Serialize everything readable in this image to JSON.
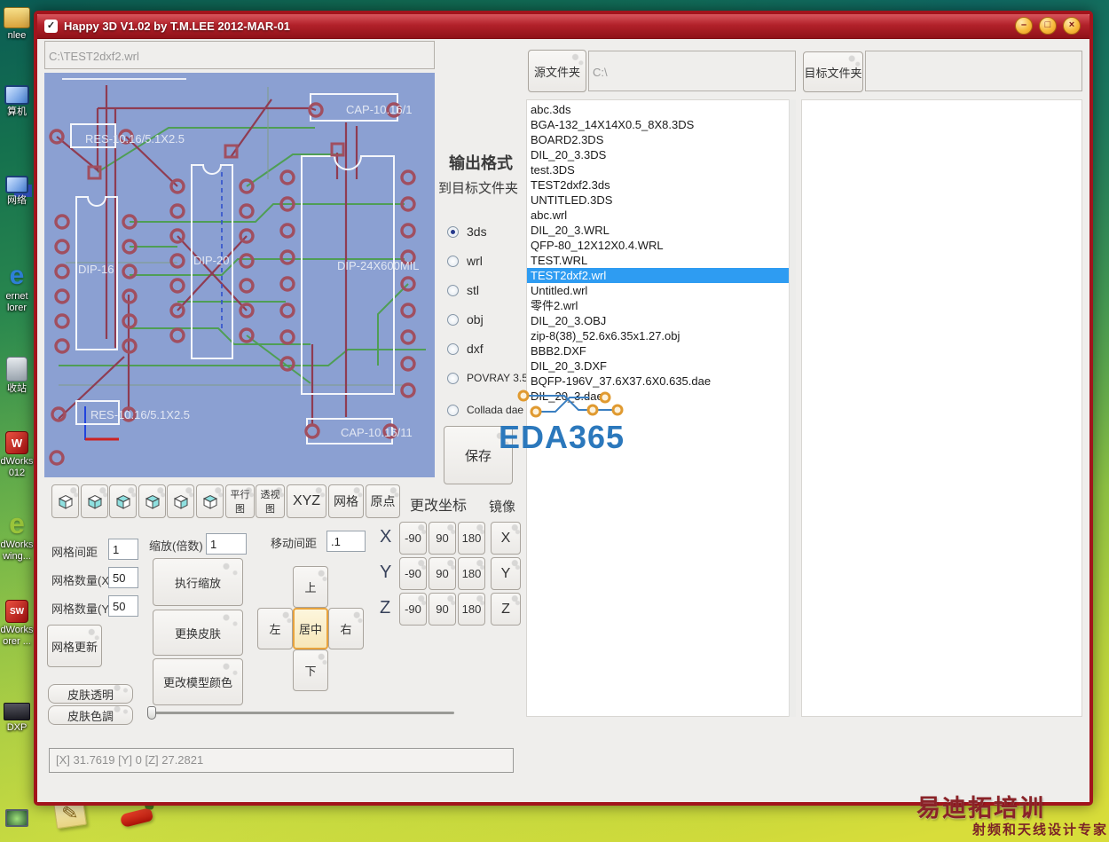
{
  "window": {
    "title": "Happy 3D V1.02 by T.M.LEE 2012-MAR-01",
    "icon_glyph": "✓",
    "controls": {
      "minimize": "–",
      "maximize": "□",
      "close": "×"
    }
  },
  "path_box": {
    "value": "C:\\TEST2dxf2.wrl"
  },
  "preview": {
    "labels": {
      "res1": "RES-10.16/5.1X2.5",
      "cap1": "CAP-10.16/1",
      "dip16": "DIP-16",
      "dip20": "DIP-20",
      "dip24": "DIP-24X600MIL",
      "res2": "RES-10.16/5.1X2.5",
      "cap2": "CAP-10.16/11"
    }
  },
  "toolbar": {
    "view_labels": [
      "平行图",
      "透视图",
      "XYZ",
      "网格",
      "原点"
    ]
  },
  "grid": {
    "spacing_label": "网格间距",
    "spacing_value": "1",
    "count_x_label": "网格数量(X)",
    "count_x_value": "50",
    "count_y_label": "网格数量(Y)",
    "count_y_value": "50",
    "update_label": "网格更新",
    "skin_transparent_label": "皮肤透明",
    "skin_tone_label": "皮肤色調"
  },
  "scale": {
    "label": "缩放(倍数)",
    "value": "1",
    "run_label": "执行缩放",
    "change_skin_label": "更换皮肤",
    "change_color_label": "更改模型颜色"
  },
  "move": {
    "label": "移动间距",
    "value": ".1",
    "up": "上",
    "left": "左",
    "center": "居中",
    "right": "右",
    "down": "下"
  },
  "rotate": {
    "heading": "更改坐标",
    "axes": [
      "X",
      "Y",
      "Z"
    ],
    "values": [
      "-90",
      "90",
      "180"
    ]
  },
  "mirror": {
    "heading": "镜像",
    "axes": [
      "X",
      "Y",
      "Z"
    ]
  },
  "status": {
    "text": "[X] 31.7619 [Y] 0 [Z] 27.2821"
  },
  "output": {
    "heading": "输出格式",
    "subheading": "到目标文件夹",
    "formats": [
      "3ds",
      "wrl",
      "stl",
      "obj",
      "dxf",
      "POVRAY 3.5",
      "Collada dae"
    ],
    "selected": "3ds",
    "save_label": "保存"
  },
  "folders": {
    "source_button": "源文件夹",
    "source_value": "C:\\",
    "target_button": "目标文件夹",
    "target_value": ""
  },
  "files": {
    "selected": "TEST2dxf2.wrl",
    "items": [
      "abc.3ds",
      "BGA-132_14X14X0.5_8X8.3DS",
      "BOARD2.3DS",
      "DIL_20_3.3DS",
      "test.3DS",
      "TEST2dxf2.3ds",
      "UNTITLED.3DS",
      "abc.wrl",
      "DIL_20_3.WRL",
      "QFP-80_12X12X0.4.WRL",
      "TEST.WRL",
      "TEST2dxf2.wrl",
      "Untitled.wrl",
      "零件2.wrl",
      "DIL_20_3.OBJ",
      "zip-8(38)_52.6x6.35x1.27.obj",
      "BBB2.DXF",
      "DIL_20_3.DXF",
      "BQFP-196V_37.6X37.6X0.635.dae",
      "DIL_20_3.dae"
    ]
  },
  "logo": {
    "text": "EDA365"
  },
  "desktop": {
    "icons": [
      {
        "l1": "nlee",
        "l2": ""
      },
      {
        "l1": "算机",
        "l2": ""
      },
      {
        "l1": "网络",
        "l2": ""
      },
      {
        "glyph": "e",
        "l1": "ernet",
        "l2": "lorer"
      },
      {
        "l1": "收站",
        "l2": ""
      },
      {
        "glyph": "W",
        "l1": "dWorks",
        "l2": "012"
      },
      {
        "glyph": "e",
        "l1": "dWorks",
        "l2": "wing..."
      },
      {
        "glyph": "SW",
        "l1": "dWorks",
        "l2": "orer ..."
      },
      {
        "l1": "DXP",
        "l2": ""
      }
    ],
    "notepad_glyph": "✎",
    "watermark": {
      "line1": "易迪拓培训",
      "line2": "射频和天线设计专家"
    }
  }
}
